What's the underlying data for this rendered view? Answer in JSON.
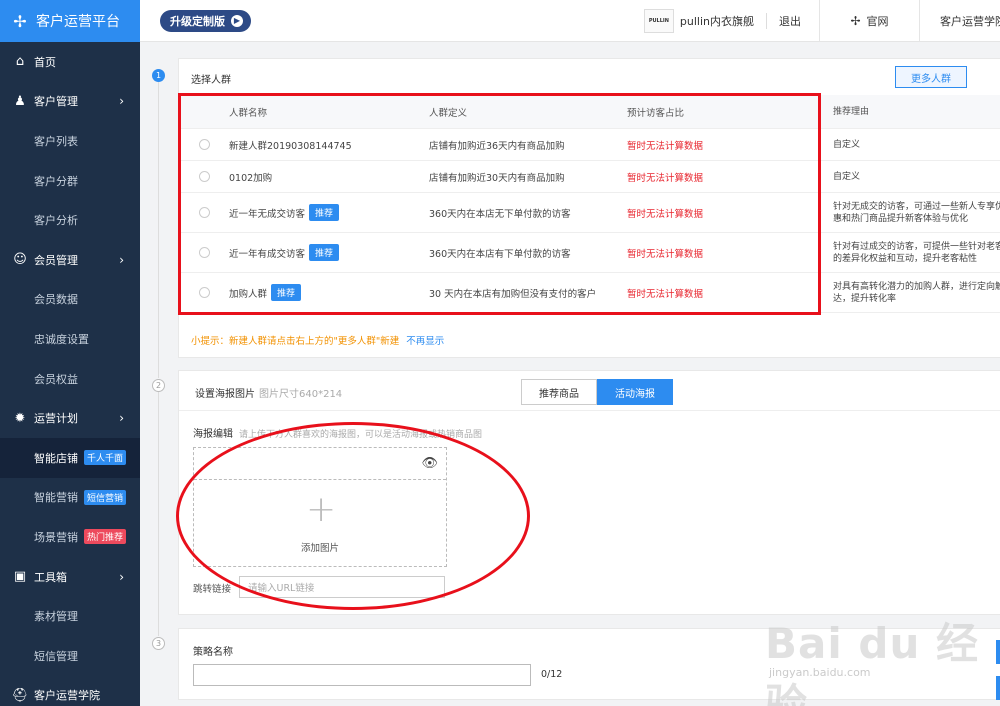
{
  "brand": {
    "title": "客户运营平台",
    "logo_icon": "pinwheel-icon"
  },
  "sidebar": {
    "items": [
      {
        "label": "首页",
        "type": "parent",
        "icon": "home-icon"
      },
      {
        "label": "客户管理",
        "type": "parent",
        "icon": "users-icon",
        "arrow": true
      },
      {
        "label": "客户列表",
        "type": "child"
      },
      {
        "label": "客户分群",
        "type": "child"
      },
      {
        "label": "客户分析",
        "type": "child"
      },
      {
        "label": "会员管理",
        "type": "parent",
        "icon": "member-icon",
        "arrow": true
      },
      {
        "label": "会员数据",
        "type": "child"
      },
      {
        "label": "忠诚度设置",
        "type": "child"
      },
      {
        "label": "会员权益",
        "type": "child"
      },
      {
        "label": "运营计划",
        "type": "parent",
        "icon": "bulb-icon",
        "arrow": true
      },
      {
        "label": "智能店铺",
        "type": "child",
        "active": true,
        "badge": "千人千面",
        "badge_color": "blue"
      },
      {
        "label": "智能营销",
        "type": "child",
        "badge": "短信营销",
        "badge_color": "blue"
      },
      {
        "label": "场景营销",
        "type": "child",
        "badge": "热门推荐",
        "badge_color": "red"
      },
      {
        "label": "工具箱",
        "type": "parent",
        "icon": "toolbox-icon",
        "arrow": true
      },
      {
        "label": "素材管理",
        "type": "child"
      },
      {
        "label": "短信管理",
        "type": "child"
      },
      {
        "label": "客户运营学院",
        "type": "parent",
        "icon": "school-icon"
      }
    ]
  },
  "topbar": {
    "upgrade_label": "升级定制版",
    "shop_logo_text": "PULLIN",
    "shop_name": "pullin内衣旗舰",
    "logout": "退出",
    "site": "官网",
    "academy": "客户运营学院"
  },
  "steps": [
    "1",
    "2",
    "3"
  ],
  "section1": {
    "title": "选择人群",
    "more_button": "更多人群",
    "columns": [
      "人群名称",
      "人群定义",
      "预计访客占比",
      "推荐理由"
    ],
    "rows": [
      {
        "name": "新建人群20190308144745",
        "tag": "",
        "definition": "店铺有加购近36天内有商品加购",
        "pct": "暂时无法计算数据",
        "reason": "自定义"
      },
      {
        "name": "0102加购",
        "tag": "",
        "definition": "店铺有加购近30天内有商品加购",
        "pct": "暂时无法计算数据",
        "reason": "自定义"
      },
      {
        "name": "近一年无成交访客",
        "tag": "推荐",
        "definition": "360天内在本店无下单付款的访客",
        "pct": "暂时无法计算数据",
        "reason": "针对无成交的访客，可通过一些新人专享优惠和热门商品提升新客体验与优化"
      },
      {
        "name": "近一年有成交访客",
        "tag": "推荐",
        "definition": "360天内在本店有下单付款的访客",
        "pct": "暂时无法计算数据",
        "reason": "针对有过成交的访客，可提供一些针对老客的差异化权益和互动，提升老客粘性"
      },
      {
        "name": "加购人群",
        "tag": "推荐",
        "definition": "30 天内在本店有加购但没有支付的客户",
        "pct": "暂时无法计算数据",
        "reason": "对具有高转化潜力的加购人群，进行定向触达，提升转化率"
      }
    ],
    "tip": "小提示：新建人群请点击右上方的\"更多人群\"新建",
    "tip_link": "不再显示"
  },
  "section2": {
    "title": "设置海报图片",
    "size_hint": "图片尺寸640*214",
    "tabs": [
      "推荐商品",
      "活动海报"
    ],
    "active_tab": 1,
    "editor_label": "海报编辑",
    "editor_hint": "请上传下方人群喜欢的海报图，可以是活动海报或热销商品图",
    "add_image": "添加图片",
    "jump_label": "跳转链接",
    "jump_placeholder": "请输入URL链接"
  },
  "section3": {
    "title": "策略名称",
    "counter": "0/12"
  },
  "watermark": {
    "main": "Bai du 经验",
    "sub": "jingyan.baidu.com"
  },
  "colors": {
    "primary": "#2d8cf0",
    "sidebar": "#1e3048",
    "warning_red": "#e8262f",
    "annotation": "#e8101b",
    "tip_orange": "#f29100"
  }
}
